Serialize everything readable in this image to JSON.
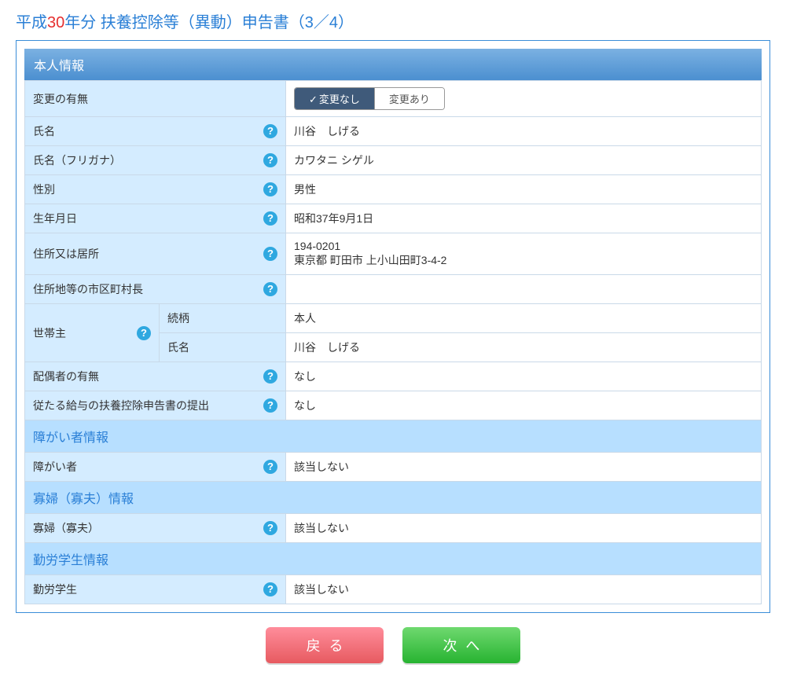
{
  "title": {
    "pre": "平成",
    "year": "30",
    "post": "年分 扶養控除等（異動）申告書（3／4）"
  },
  "panelTitle": "本人情報",
  "changeRow": {
    "label": "変更の有無",
    "optNoChange": "変更なし",
    "optChange": "変更あり",
    "checkMark": "✓"
  },
  "fields": {
    "name": {
      "label": "氏名",
      "value": "川谷　しげる"
    },
    "kana": {
      "label": "氏名（フリガナ）",
      "value": "カワタニ シゲル"
    },
    "sex": {
      "label": "性別",
      "value": "男性"
    },
    "dob": {
      "label": "生年月日",
      "value": "昭和37年9月1日"
    },
    "address": {
      "label": "住所又は居所",
      "value": "194-0201\n東京都 町田市 上小山田町3-4-2"
    },
    "mayor": {
      "label": "住所地等の市区町村長",
      "value": ""
    },
    "household": {
      "label": "世帯主",
      "relationLabel": "続柄",
      "relationValue": "本人",
      "nameLabel": "氏名",
      "nameValue": "川谷　しげる"
    },
    "spouse": {
      "label": "配偶者の有無",
      "value": "なし"
    },
    "secondary": {
      "label": "従たる給与の扶養控除申告書の提出",
      "value": "なし"
    }
  },
  "sections": {
    "disability": {
      "title": "障がい者情報",
      "row": {
        "label": "障がい者",
        "value": "該当しない"
      }
    },
    "widow": {
      "title": "寡婦（寡夫）情報",
      "row": {
        "label": "寡婦（寡夫）",
        "value": "該当しない"
      }
    },
    "student": {
      "title": "勤労学生情報",
      "row": {
        "label": "勤労学生",
        "value": "該当しない"
      }
    }
  },
  "helpGlyph": "?",
  "buttons": {
    "back": "戻る",
    "next": "次へ"
  }
}
